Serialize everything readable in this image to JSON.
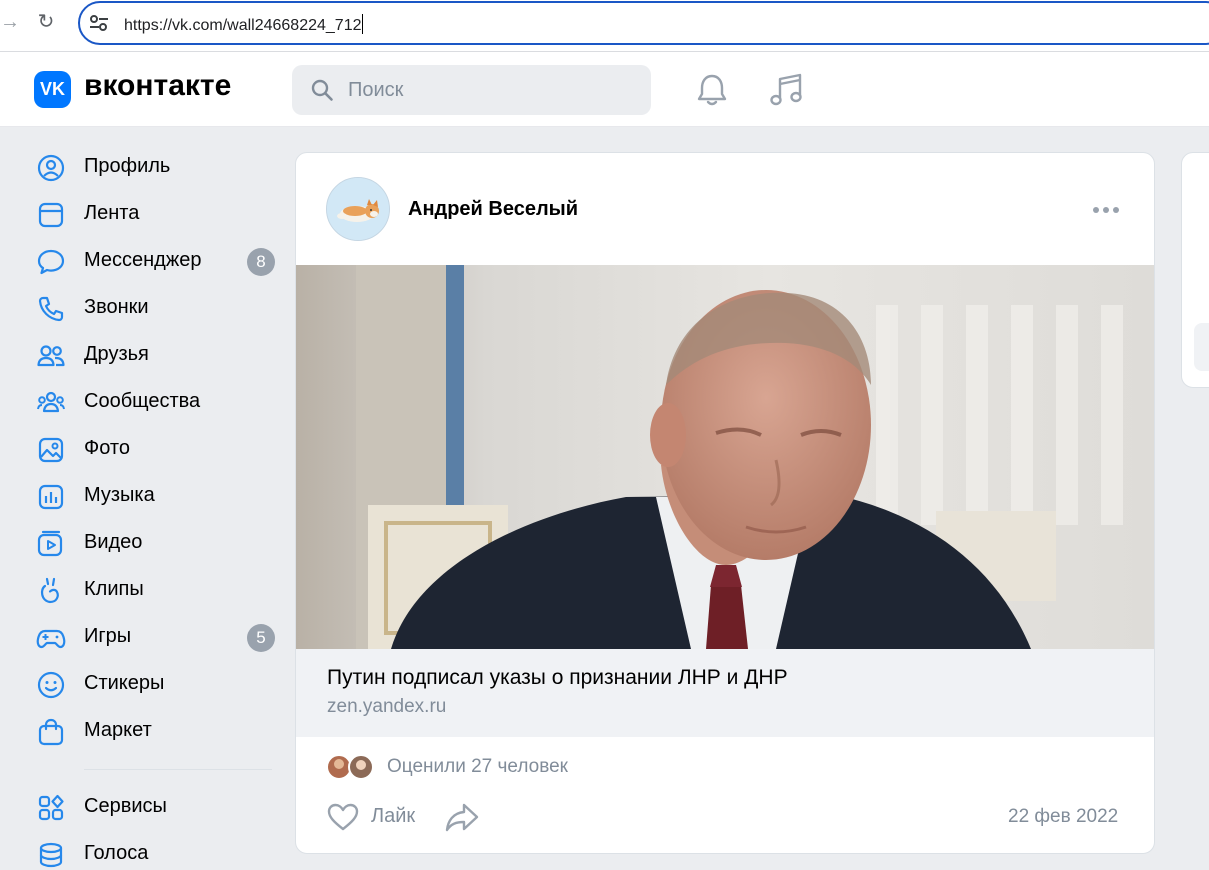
{
  "browser": {
    "url": "https://vk.com/wall24668224_712"
  },
  "header": {
    "logo_text": "VK",
    "wordmark": "вконтакте",
    "search_placeholder": "Поиск"
  },
  "sidebar": {
    "items": [
      {
        "label": "Профиль",
        "icon": "profile-icon"
      },
      {
        "label": "Лента",
        "icon": "feed-icon"
      },
      {
        "label": "Мессенджер",
        "icon": "messenger-icon",
        "badge": "8"
      },
      {
        "label": "Звонки",
        "icon": "phone-icon"
      },
      {
        "label": "Друзья",
        "icon": "friends-icon"
      },
      {
        "label": "Сообщества",
        "icon": "communities-icon"
      },
      {
        "label": "Фото",
        "icon": "photo-icon"
      },
      {
        "label": "Музыка",
        "icon": "music-icon"
      },
      {
        "label": "Видео",
        "icon": "video-icon"
      },
      {
        "label": "Клипы",
        "icon": "clips-icon"
      },
      {
        "label": "Игры",
        "icon": "games-icon",
        "badge": "5"
      },
      {
        "label": "Стикеры",
        "icon": "stickers-icon"
      },
      {
        "label": "Маркет",
        "icon": "market-icon"
      },
      {
        "label": "Сервисы",
        "icon": "services-icon"
      },
      {
        "label": "Голоса",
        "icon": "votes-icon"
      }
    ]
  },
  "post": {
    "author": "Андрей Веселый",
    "link_title": "Путин подписал указы о признании ЛНР и ДНР",
    "link_source": "zen.yandex.ru",
    "likes_text": "Оценили 27 человек",
    "like_label": "Лайк",
    "date": "22 фев 2022"
  },
  "colors": {
    "accent": "#0077ff",
    "page_bg": "#ebedf0",
    "muted_text": "#818c99",
    "badge": "#99a2ad",
    "icon": "#2688eb"
  }
}
